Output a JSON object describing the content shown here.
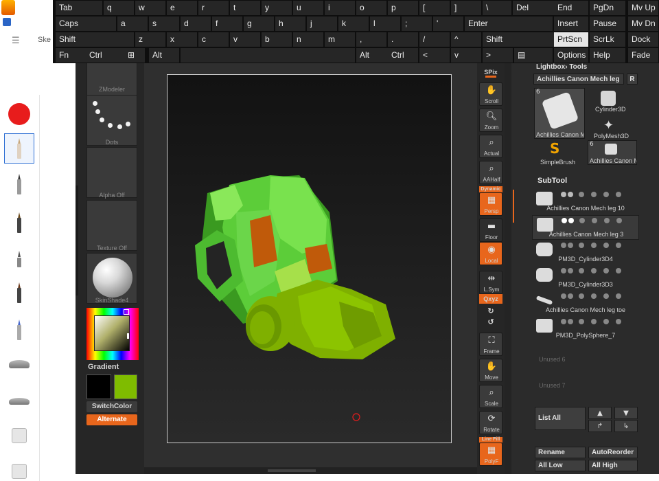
{
  "sketch": {
    "title": "Ske"
  },
  "keyboard": {
    "rows": [
      [
        {
          "label": "Tab",
          "sub": ""
        },
        {
          "label": "q",
          "sub": ""
        },
        {
          "label": "w",
          "sub": ""
        },
        {
          "label": "e",
          "sub": ""
        },
        {
          "label": "r",
          "sub": ""
        },
        {
          "label": "t",
          "sub": ""
        },
        {
          "label": "y",
          "sub": ""
        },
        {
          "label": "u",
          "sub": ""
        },
        {
          "label": "i",
          "sub": ""
        },
        {
          "label": "o",
          "sub": ""
        },
        {
          "label": "p",
          "sub": ""
        },
        {
          "label": "[",
          "sub": ""
        },
        {
          "label": "]",
          "sub": ""
        },
        {
          "label": "\\",
          "sub": ""
        },
        {
          "label": "Del",
          "sub": ""
        },
        {
          "label": "End",
          "sub": ""
        },
        {
          "label": "PgDn",
          "sub": ""
        },
        {
          "label": "Mv Up",
          "sub": ""
        }
      ],
      [
        {
          "label": "Caps",
          "sub": ""
        },
        {
          "label": "a",
          "sub": ""
        },
        {
          "label": "s",
          "sub": ""
        },
        {
          "label": "d",
          "sub": ""
        },
        {
          "label": "f",
          "sub": ""
        },
        {
          "label": "g",
          "sub": ""
        },
        {
          "label": "h",
          "sub": ""
        },
        {
          "label": "j",
          "sub": ""
        },
        {
          "label": "k",
          "sub": ""
        },
        {
          "label": "l",
          "sub": ""
        },
        {
          "label": ";",
          "sub": ""
        },
        {
          "label": "'",
          "sub": ""
        },
        {
          "label": "Enter",
          "sub": ""
        },
        {
          "label": "Insert",
          "sub": ""
        },
        {
          "label": "Pause",
          "sub": ""
        },
        {
          "label": "Mv Dn",
          "sub": ""
        }
      ],
      [
        {
          "label": "Shift",
          "sub": ""
        },
        {
          "label": "z",
          "sub": ""
        },
        {
          "label": "x",
          "sub": ""
        },
        {
          "label": "c",
          "sub": ""
        },
        {
          "label": "v",
          "sub": ""
        },
        {
          "label": "b",
          "sub": ""
        },
        {
          "label": "n",
          "sub": ""
        },
        {
          "label": "m",
          "sub": ""
        },
        {
          "label": ",",
          "sub": ""
        },
        {
          "label": ".",
          "sub": ""
        },
        {
          "label": "/",
          "sub": ""
        },
        {
          "label": "^",
          "sub": ""
        },
        {
          "label": "Shift",
          "sub": ""
        },
        {
          "label": "PrtScn",
          "sub": ""
        },
        {
          "label": "ScrLk",
          "sub": ""
        },
        {
          "label": "Dock",
          "sub": ""
        }
      ],
      [
        {
          "label": "Fn",
          "sub": ""
        },
        {
          "label": "Ctrl",
          "sub": ""
        },
        {
          "label": "⊞",
          "sub": ""
        },
        {
          "label": "Alt",
          "sub": ""
        },
        {
          "label": "",
          "sub": ""
        },
        {
          "label": "Alt",
          "sub": ""
        },
        {
          "label": "Ctrl",
          "sub": ""
        },
        {
          "label": "<",
          "sub": ""
        },
        {
          "label": "v",
          "sub": ""
        },
        {
          "label": ">",
          "sub": ""
        },
        {
          "label": "▤",
          "sub": ""
        },
        {
          "label": "Options",
          "sub": ""
        },
        {
          "label": "Help",
          "sub": ""
        },
        {
          "label": "Fade",
          "sub": ""
        }
      ]
    ],
    "highlighted": "PrtScn"
  },
  "zbrush": {
    "left_slots": [
      {
        "label": "ZModeler"
      },
      {
        "label": "Dots"
      },
      {
        "label": "Alpha Off"
      },
      {
        "label": "Texture Off"
      },
      {
        "label": "SkinShade4"
      }
    ],
    "gradient_label": "Gradient",
    "switchcolor_label": "SwitchColor",
    "alternate_label": "Alternate",
    "right_buttons": [
      {
        "label": "SPix",
        "icon": "spix-slider"
      },
      {
        "label": "Scroll",
        "icon": "hand-icon"
      },
      {
        "label": "Zoom",
        "icon": "zoom-icon"
      },
      {
        "label": "Actual",
        "icon": "actual-icon"
      },
      {
        "label": "AAHalf",
        "icon": "aahalf-icon"
      },
      {
        "label": "Persp",
        "icon": "persp-icon"
      },
      {
        "label": "Floor",
        "icon": "floor-icon"
      },
      {
        "label": "Local",
        "icon": "local-icon"
      },
      {
        "label": "L.Sym",
        "icon": "lsym-icon"
      },
      {
        "label": "Qxyz",
        "icon": "xyz-icon"
      },
      {
        "label": "Frame",
        "icon": "frame-icon"
      },
      {
        "label": "Move",
        "icon": "move-icon"
      },
      {
        "label": "Scale",
        "icon": "scale-icon"
      },
      {
        "label": "Rotate",
        "icon": "rotate-icon"
      },
      {
        "label": "PolyF",
        "icon": "polyf-icon"
      }
    ],
    "dynamic_label": "Dynamic",
    "linefill_label": "Line Fill",
    "tool_panel": {
      "lightbox_tools": "Lightbox› Tools",
      "current_tool": "Achillies Canon Mech leg",
      "r_button": "R",
      "tools": [
        {
          "label": "Achillies Canon M",
          "count": "6"
        },
        {
          "label": "Cylinder3D",
          "count": ""
        },
        {
          "label": "PolyMesh3D",
          "count": ""
        },
        {
          "label": "SimpleBrush",
          "count": ""
        },
        {
          "label": "Achillies Canon M",
          "count": "6"
        }
      ],
      "subtool_title": "SubTool",
      "subtools": [
        {
          "name": "Achillies Canon Mech leg 10"
        },
        {
          "name": "Achillies Canon Mech leg 3"
        },
        {
          "name": "PM3D_Cylinder3D4"
        },
        {
          "name": "PM3D_Cylinder3D3"
        },
        {
          "name": "Achillies Canon Mech leg toe"
        },
        {
          "name": "PM3D_PolySphere_7"
        }
      ],
      "unused": [
        "Unused 6",
        "Unused 7"
      ],
      "list_all": "List All",
      "rename": "Rename",
      "autoreorder": "AutoReorder",
      "all_low": "All Low",
      "all_high": "All High"
    }
  },
  "colors": {
    "accent_orange": "#e8661c",
    "mesh_green": "#6bd64a",
    "mesh_olive": "#7fb000",
    "primary_red": "#e81c1c"
  }
}
